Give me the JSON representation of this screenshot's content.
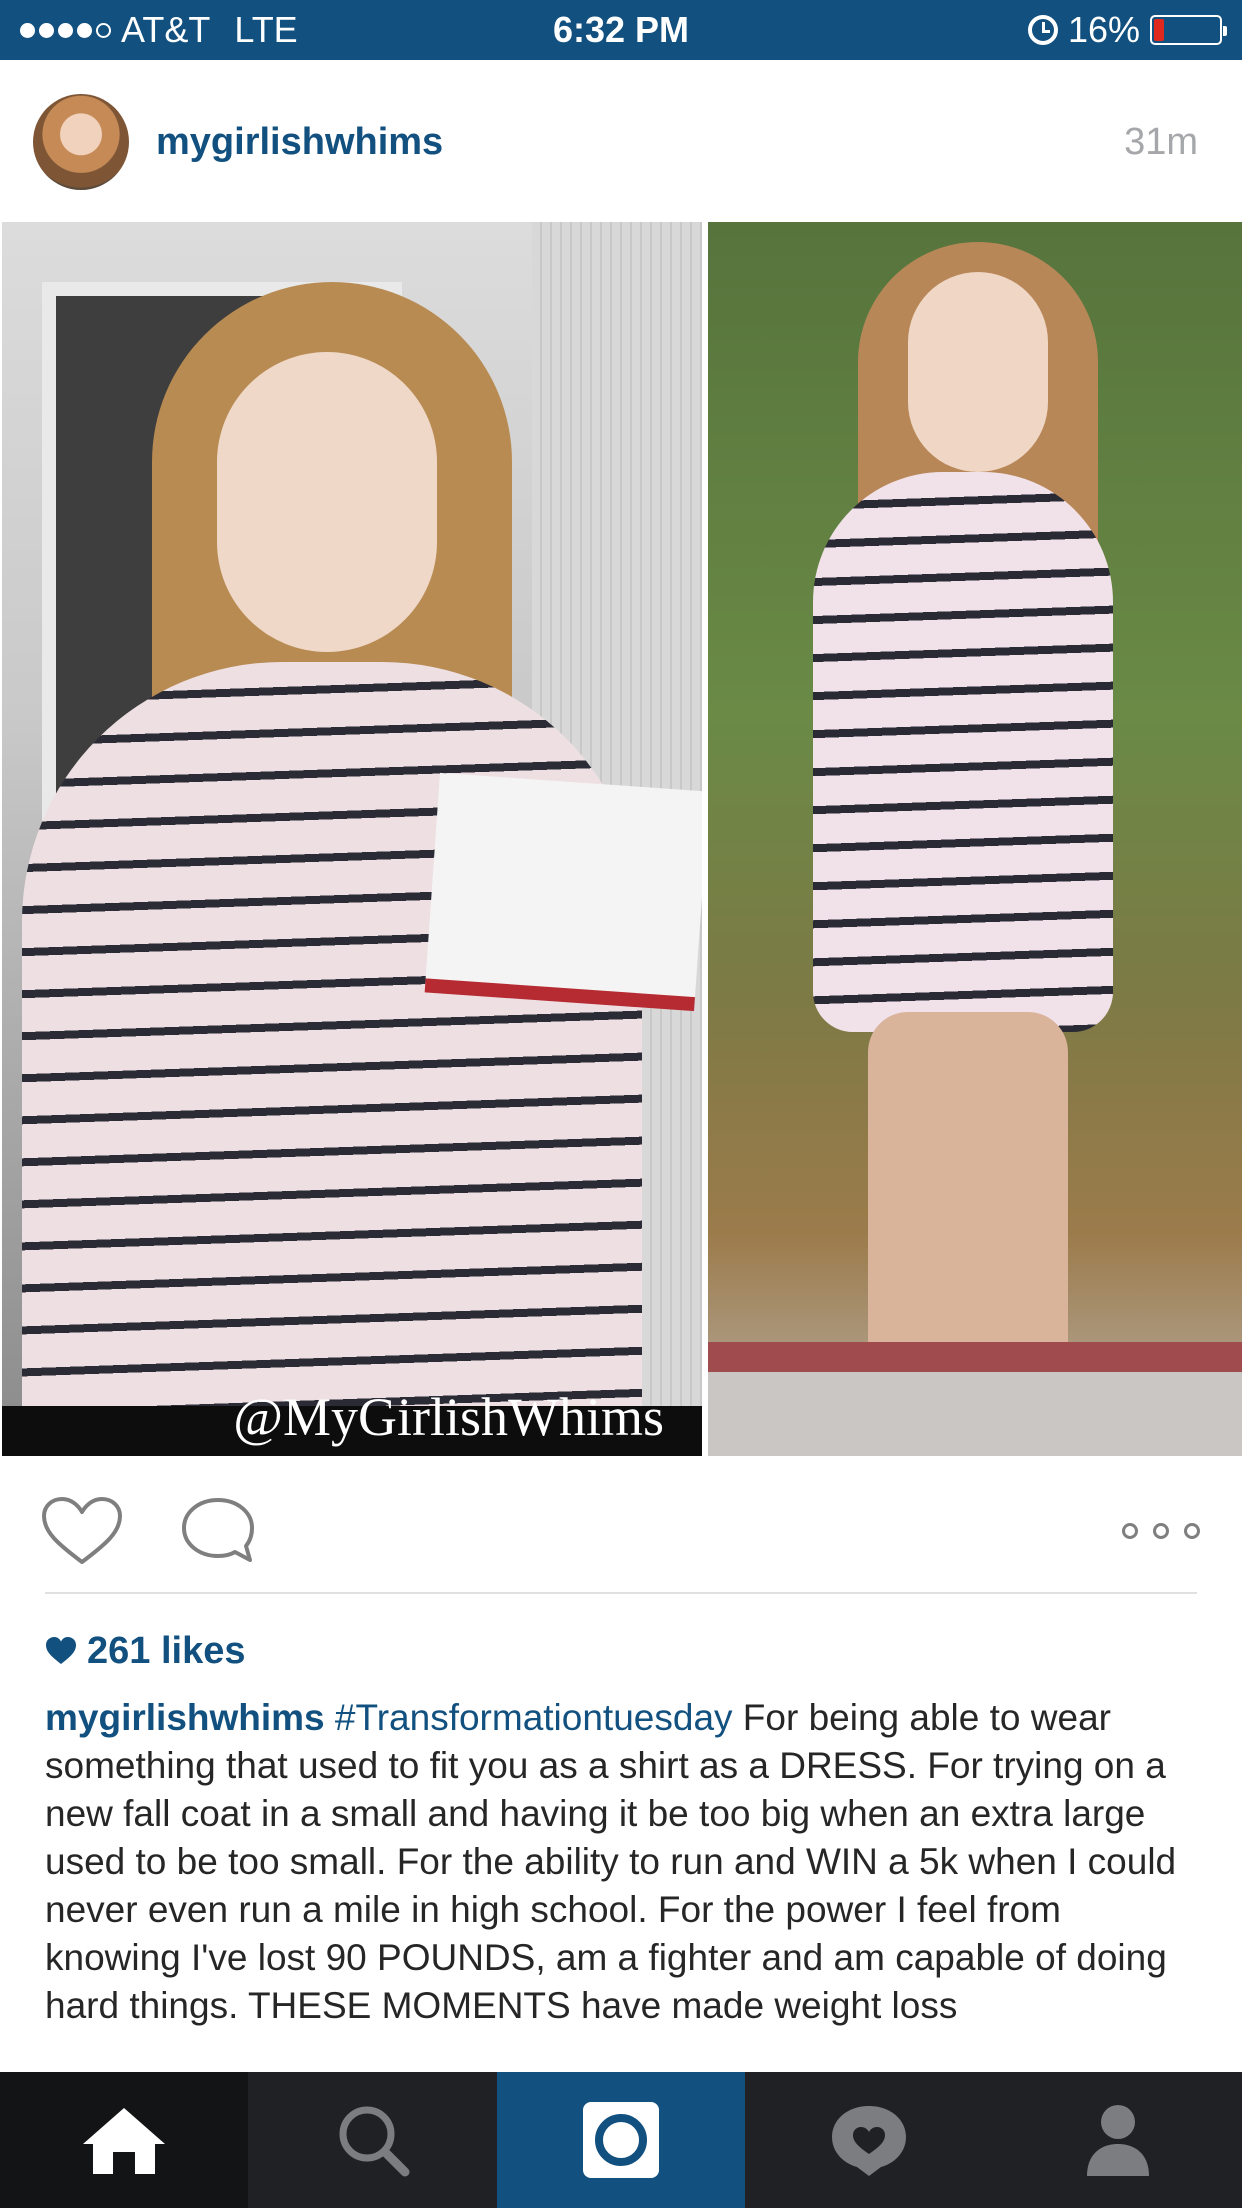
{
  "status_bar": {
    "carrier": "AT&T",
    "network": "LTE",
    "time": "6:32 PM",
    "battery_percent": "16%",
    "battery_level": 0.16,
    "signal_bars_filled": 4,
    "signal_bars_total": 5,
    "icons": [
      "signal-dots-icon",
      "alarm-icon",
      "battery-icon"
    ]
  },
  "post": {
    "username": "mygirlishwhims",
    "time_ago": "31m",
    "photo": {
      "watermark": "@MyGirlishWhims"
    },
    "actions": {
      "icons": [
        "heart-icon",
        "comment-icon",
        "more-options-icon"
      ]
    },
    "likes": "261 likes",
    "caption": {
      "username": "mygirlishwhims",
      "hashtag": "#Transformationtuesday",
      "text": " For being able to wear something that used to fit you as a shirt as a DRESS. For trying on a new fall coat in a small and having it be too big when an extra large used to be too small. For the ability to run and WIN a 5k when I could never even run a mile in high school. For the power I feel from knowing I've lost 90 POUNDS, am a fighter and am capable of doing hard things. THESE MOMENTS have made weight loss"
    }
  },
  "tab_bar": {
    "tabs": [
      "home-icon",
      "search-icon",
      "camera-icon",
      "activity-icon",
      "profile-icon"
    ],
    "active": "home-icon"
  },
  "colors": {
    "brand_blue": "#11507f",
    "tab_bar": "#1f2124",
    "battery_low": "#e0291e",
    "timestamp_gray": "#a5a7aa"
  }
}
